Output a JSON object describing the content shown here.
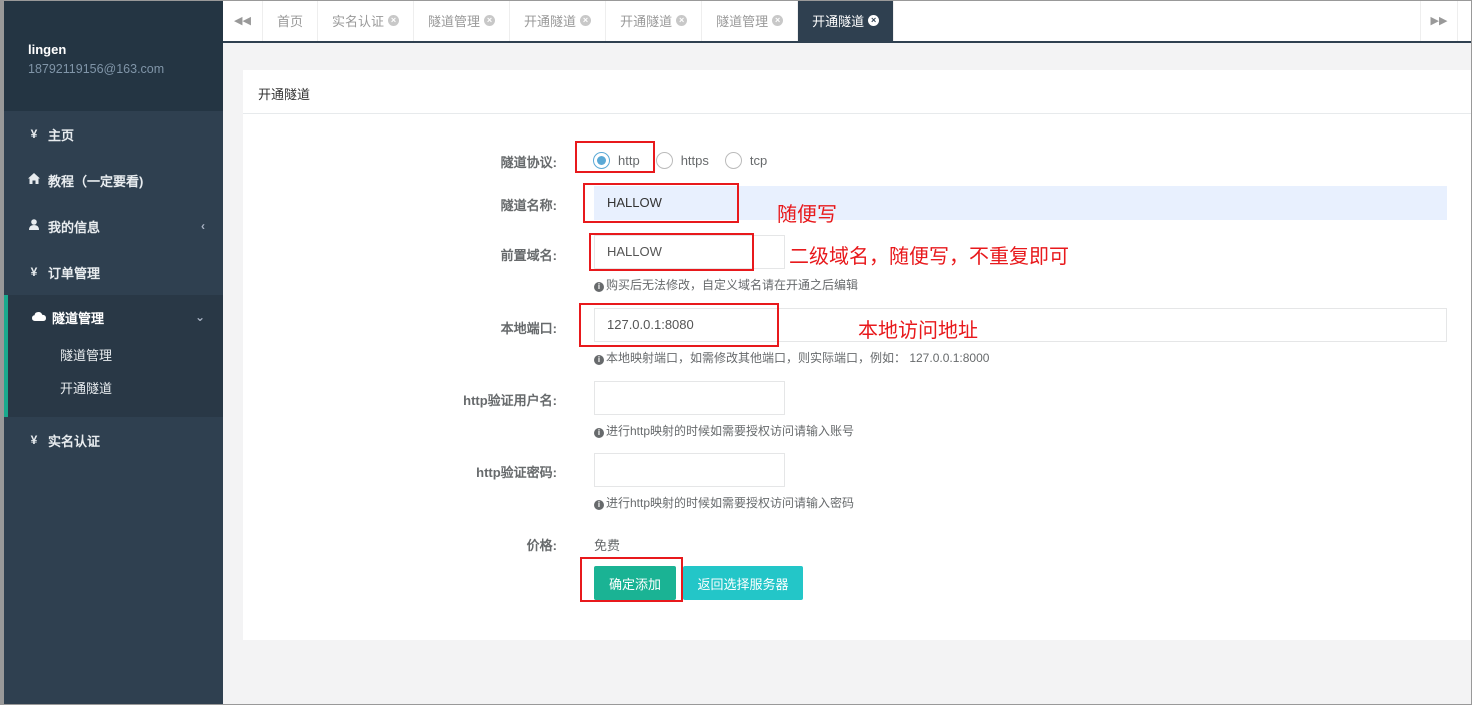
{
  "user": {
    "name": "lingen",
    "email": "18792119156@163.com"
  },
  "sidebar": {
    "items": [
      {
        "icon": "¥",
        "label": "主页"
      },
      {
        "icon": "home-icon",
        "label": "教程（一定要看)"
      },
      {
        "icon": "user-icon",
        "label": "我的信息"
      },
      {
        "icon": "¥",
        "label": "订单管理"
      },
      {
        "icon": "cloud-icon",
        "label": "隧道管理"
      },
      {
        "icon": "¥",
        "label": "实名认证"
      }
    ],
    "subitems": [
      "隧道管理",
      "开通隧道"
    ],
    "accent": "#19aa8d"
  },
  "tabs": [
    "首页",
    "实名认证",
    "隧道管理",
    "开通隧道",
    "开通隧道",
    "隧道管理",
    "开通隧道"
  ],
  "panel": {
    "title": "开通隧道",
    "protocol_label": "隧道协议:",
    "protocols": [
      "http",
      "https",
      "tcp"
    ],
    "protocol_selected": "http",
    "name_label": "隧道名称:",
    "name_value": "HALLOW",
    "domain_label": "前置域名:",
    "domain_value": "HALLOW",
    "domain_help": "购买后无法修改，自定义域名请在开通之后编辑",
    "port_label": "本地端口:",
    "port_value": "127.0.0.1:8080",
    "port_help": "本地映射端口，如需修改其他端口，则实际端口，例如：  127.0.0.1:8000",
    "user_label": "http验证用户名:",
    "user_help": "进行http映射的时候如需要授权访问请输入账号",
    "pass_label": "http验证密码:",
    "pass_help": "进行http映射的时候如需要授权访问请输入密码",
    "price_label": "价格:",
    "price_value": "免费",
    "confirm_button": "确定添加",
    "back_button": "返回选择服务器"
  },
  "annotations": {
    "name_note": "随便写",
    "domain_note": "二级域名，随便写，不重复即可",
    "port_note": "本地访问地址",
    "color": "#e8191c"
  }
}
